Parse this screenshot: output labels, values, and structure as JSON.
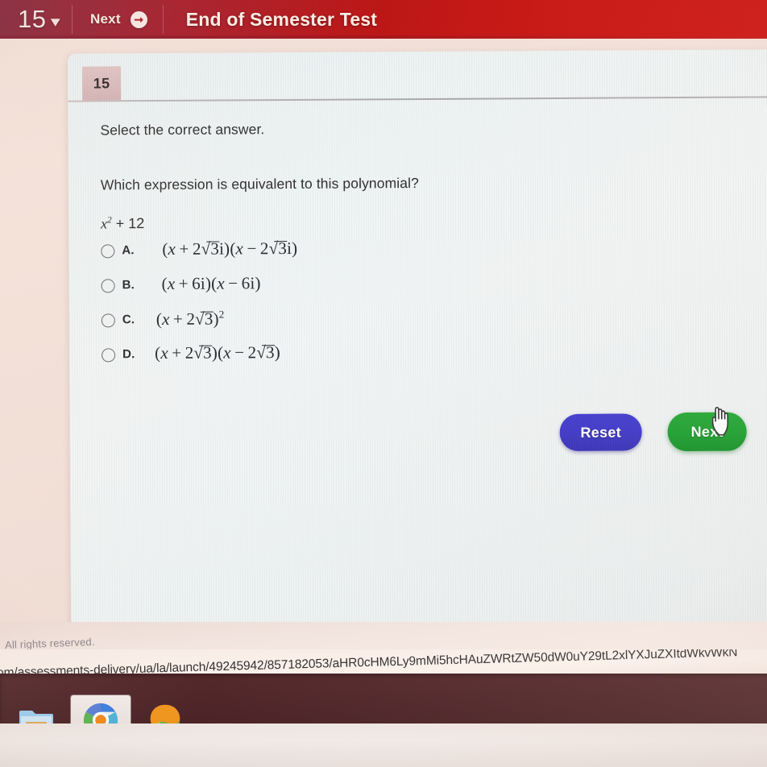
{
  "top_bar": {
    "question_number": "15",
    "chevron_icon": "chevron-down-icon",
    "next_label": "Next",
    "next_arrow_icon": "arrow-right-circle-icon",
    "test_title": "End of Semester Test",
    "bar_color": "#c71512"
  },
  "card": {
    "question_tab_number": "15",
    "tab_color": "#d9b9ba",
    "prompt_select": "Select the correct answer.",
    "prompt_question": "Which expression is equivalent to this polynomial?",
    "polynomial": {
      "variable": "x",
      "exponent": "2",
      "rest": "+ 12",
      "plain": "x^2 + 12"
    }
  },
  "options": [
    {
      "letter": "A.",
      "selected": false,
      "expression_plain": "(x + 2√3i)(x − 2√3i)",
      "parts": {
        "l1": "(",
        "v1": "x",
        "op1": "+",
        "c1": "2",
        "r1": "3",
        "i1": "i",
        "e1": ")",
        "l2": "(",
        "v2": "x",
        "op2": "−",
        "c2": "2",
        "r2": "3",
        "i2": "i",
        "e2": ")"
      }
    },
    {
      "letter": "B.",
      "selected": false,
      "expression_plain": "(x + 6i)(x − 6i)",
      "parts": {
        "l1": "(",
        "v1": "x",
        "op1": "+",
        "c1": "6i",
        "e1": ")",
        "l2": "(",
        "v2": "x",
        "op2": "−",
        "c2": "6i",
        "e2": ")"
      }
    },
    {
      "letter": "C.",
      "selected": false,
      "expression_plain": "(x + 2√3)²",
      "parts": {
        "l1": "(",
        "v1": "x",
        "op1": "+",
        "c1": "2",
        "r1": "3",
        "e1": ")",
        "sup": "2"
      }
    },
    {
      "letter": "D.",
      "selected": false,
      "expression_plain": "(x + 2√3)(x − 2√3)",
      "parts": {
        "l1": "(",
        "v1": "x",
        "op1": "+",
        "c1": "2",
        "r1": "3",
        "e1": ")",
        "l2": "(",
        "v2": "x",
        "op2": "−",
        "c2": "2",
        "r2": "3",
        "e2": ")"
      }
    }
  ],
  "buttons": {
    "reset_label": "Reset",
    "reset_color": "#3a33c6",
    "next_label": "Next",
    "next_color": "#159e28",
    "cursor_icon": "pointing-hand-cursor"
  },
  "footer": {
    "copyright_text": "All rights reserved.",
    "url_text": "om/assessments-delivery/ua/la/launch/49245942/857182053/aHR0cHM6Ly9mMi5hcHAuZWRtZW50dW0uY29tL2xlYXJuZXItdWkvWkN"
  },
  "taskbar": {
    "items": [
      {
        "icon": "file-explorer-icon",
        "active": false
      },
      {
        "icon": "chrome-icon",
        "active": true
      },
      {
        "icon": "edge-icon",
        "active": false
      }
    ]
  }
}
